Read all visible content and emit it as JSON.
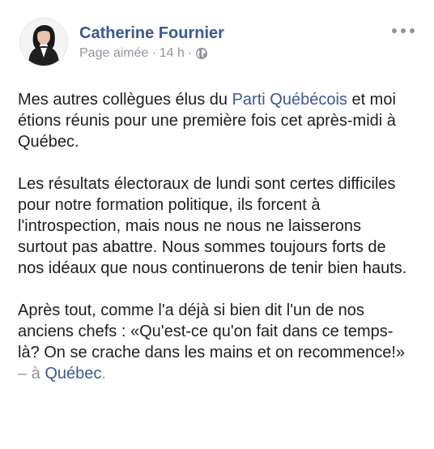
{
  "post": {
    "author": "Catherine Fournier",
    "page_label": "Page aimée",
    "separator": "·",
    "time": "14 h",
    "separator2": "·",
    "privacy_icon": "globe-icon",
    "more_icon": "more-options-icon",
    "paragraph1": {
      "before": "Mes autres collègues élus du ",
      "link": "Parti Québécois",
      "after": " et moi étions réunis pour une première fois cet après-midi à Québec."
    },
    "paragraph2": "Les résultats électoraux de lundi sont certes difficiles pour notre formation politique, ils forcent à l'introspection, mais nous ne nous ne laisserons surtout pas abattre. Nous sommes toujours forts de nos idéaux que nous continuerons de tenir bien hauts.",
    "paragraph3": {
      "text": "Après tout, comme l'a déjà si bien dit l'un de nos anciens chefs : «Qu'est-ce qu'on fait dans ce temps-là? On se crache dans les mains et on recommence!»",
      "location_prefix": " – à ",
      "location_link": "Québec",
      "location_suffix": "."
    }
  },
  "colors": {
    "link": "#385898",
    "muted": "#90949c",
    "text": "#1c1e21"
  }
}
